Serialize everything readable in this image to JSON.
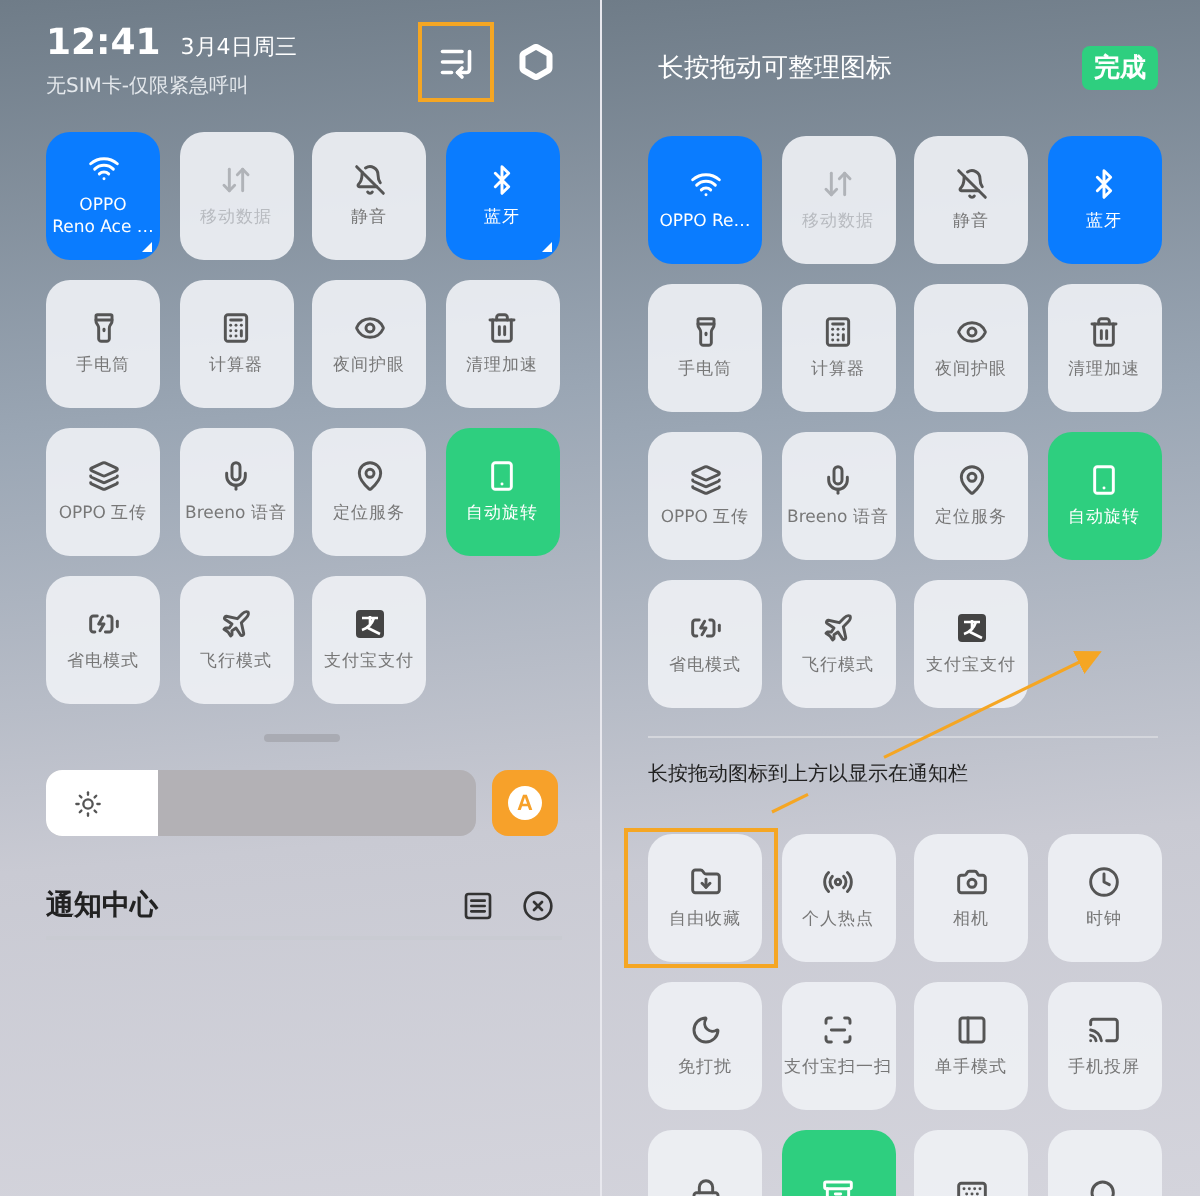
{
  "left_panel": {
    "time": "12:41",
    "date": "3月4日周三",
    "carrier": "无SIM卡-仅限紧急呼叫",
    "sort_button": {
      "highlighted": true
    },
    "tiles": [
      {
        "label": "OPPO\nReno Ace …",
        "on": true,
        "disabled": false,
        "color": "#0a7cff",
        "has_detail": true
      },
      {
        "label": "移动数据",
        "on": false,
        "disabled": true,
        "has_detail": false
      },
      {
        "label": "静音",
        "on": false,
        "disabled": false,
        "has_detail": false
      },
      {
        "label": "蓝牙",
        "on": true,
        "disabled": false,
        "color": "#0a7cff",
        "has_detail": true
      },
      {
        "label": "手电筒",
        "on": false,
        "disabled": false,
        "has_detail": false
      },
      {
        "label": "计算器",
        "on": false,
        "disabled": false,
        "has_detail": false
      },
      {
        "label": "夜间护眼",
        "on": false,
        "disabled": false,
        "has_detail": false
      },
      {
        "label": "清理加速",
        "on": false,
        "disabled": false,
        "has_detail": false
      },
      {
        "label": "OPPO 互传",
        "on": false,
        "disabled": false,
        "has_detail": false
      },
      {
        "label": "Breeno 语音",
        "on": false,
        "disabled": false,
        "has_detail": false
      },
      {
        "label": "定位服务",
        "on": false,
        "disabled": false,
        "has_detail": false
      },
      {
        "label": "自动旋转",
        "on": true,
        "disabled": false,
        "color": "#2ecf7f",
        "has_detail": false
      },
      {
        "label": "省电模式",
        "on": false,
        "disabled": false,
        "has_detail": false
      },
      {
        "label": "飞行模式",
        "on": false,
        "disabled": false,
        "has_detail": false
      },
      {
        "label": "支付宝支付",
        "on": false,
        "disabled": false,
        "has_detail": false
      }
    ],
    "brightness": {
      "level": 0.26
    },
    "auto_brightness": {
      "label": "A",
      "on": true
    },
    "notification_center": {
      "title": "通知中心"
    }
  },
  "right_panel": {
    "title": "长按拖动可整理图标",
    "done_button": "完成",
    "tiles": [
      {
        "label": "OPPO Re…",
        "on": true,
        "disabled": false,
        "color": "#0a7cff"
      },
      {
        "label": "移动数据",
        "on": false,
        "disabled": true
      },
      {
        "label": "静音",
        "on": false,
        "disabled": false
      },
      {
        "label": "蓝牙",
        "on": true,
        "disabled": false,
        "color": "#0a7cff"
      },
      {
        "label": "手电筒",
        "on": false,
        "disabled": false
      },
      {
        "label": "计算器",
        "on": false,
        "disabled": false
      },
      {
        "label": "夜间护眼",
        "on": false,
        "disabled": false
      },
      {
        "label": "清理加速",
        "on": false,
        "disabled": false
      },
      {
        "label": "OPPO 互传",
        "on": false,
        "disabled": false
      },
      {
        "label": "Breeno 语音",
        "on": false,
        "disabled": false
      },
      {
        "label": "定位服务",
        "on": false,
        "disabled": false
      },
      {
        "label": "自动旋转",
        "on": true,
        "disabled": false,
        "color": "#2ecf7f"
      },
      {
        "label": "省电模式",
        "on": false,
        "disabled": false
      },
      {
        "label": "飞行模式",
        "on": false,
        "disabled": false
      },
      {
        "label": "支付宝支付",
        "on": false,
        "disabled": false
      }
    ],
    "hint": "长按拖动图标到上方以显示在通知栏",
    "available_tiles": [
      {
        "label": "自由收藏",
        "on": false,
        "highlighted": true
      },
      {
        "label": "个人热点",
        "on": false,
        "highlighted": false
      },
      {
        "label": "相机",
        "on": false,
        "highlighted": false
      },
      {
        "label": "时钟",
        "on": false,
        "highlighted": false
      },
      {
        "label": "免打扰",
        "on": false,
        "highlighted": false
      },
      {
        "label": "支付宝扫一扫",
        "on": false,
        "highlighted": false
      },
      {
        "label": "单手模式",
        "on": false,
        "highlighted": false
      },
      {
        "label": "手机投屏",
        "on": false,
        "highlighted": false
      },
      {
        "on": false,
        "highlighted": false
      },
      {
        "on": true,
        "color": "#2ecf7f",
        "highlighted": false
      },
      {
        "on": false,
        "highlighted": false
      },
      {
        "on": false,
        "highlighted": false
      }
    ]
  }
}
